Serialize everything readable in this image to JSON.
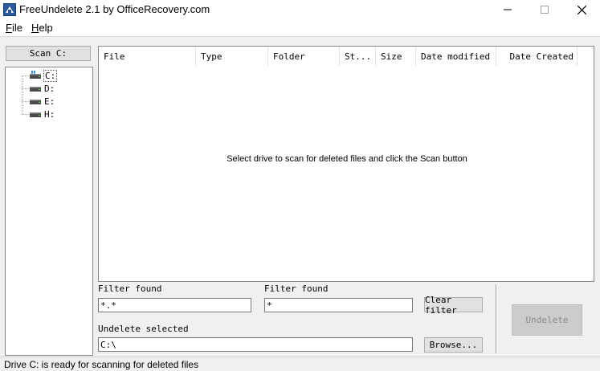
{
  "window": {
    "title": "FreeUndelete 2.1 by OfficeRecovery.com"
  },
  "menu": {
    "items": [
      "File",
      "Help"
    ]
  },
  "left_panel": {
    "scan_button": "Scan C:",
    "drives": [
      {
        "label": "C:",
        "selected": true
      },
      {
        "label": "D:"
      },
      {
        "label": "E:"
      },
      {
        "label": "H:"
      }
    ]
  },
  "list": {
    "columns": [
      "File",
      "Type",
      "Folder",
      "St...",
      "Size",
      "Date modified",
      "Date Created"
    ],
    "empty_message": "Select drive to scan for deleted files and click the Scan button"
  },
  "filters": {
    "filter1_label": "Filter found",
    "filter1_value": "*.*",
    "filter2_label": "Filter found",
    "filter2_value": "*",
    "clear_button": "Clear filter"
  },
  "undelete": {
    "label": "Undelete selected",
    "path_value": "C:\\",
    "browse_button": "Browse...",
    "undelete_button": "Undelete"
  },
  "status": {
    "text": "Drive C: is ready for scanning for deleted files"
  }
}
